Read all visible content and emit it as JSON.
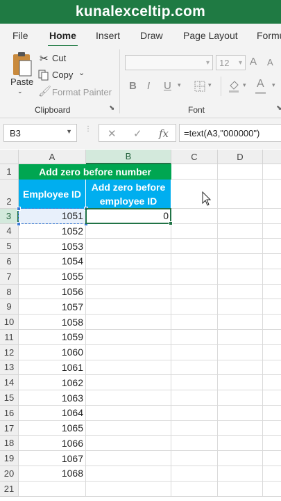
{
  "banner": {
    "text": "kunalexceltip.com",
    "bg": "#1f7a43"
  },
  "ribbon_tabs": [
    "File",
    "Home",
    "Insert",
    "Draw",
    "Page Layout",
    "Formu"
  ],
  "active_tab": "Home",
  "clipboard": {
    "paste_label": "Paste",
    "cut_label": "Cut",
    "copy_label": "Copy",
    "format_painter_label": "Format Painter",
    "group_label": "Clipboard"
  },
  "font": {
    "size_value": "12",
    "group_label": "Font",
    "bold": "B",
    "italic": "I",
    "underline": "U",
    "grow": "A",
    "shrink": "A"
  },
  "formula_bar": {
    "name_box": "B3",
    "cancel_icon": "✕",
    "enter_icon": "✓",
    "fx_label": "fx",
    "formula": "=text(A3,\"000000\")"
  },
  "columns": [
    "A",
    "B",
    "C",
    "D"
  ],
  "selected_column": "B",
  "rows": [
    "1",
    "2",
    "3",
    "4",
    "5",
    "6",
    "7",
    "8",
    "9",
    "10",
    "11",
    "12",
    "13",
    "14",
    "15",
    "16",
    "17",
    "18",
    "19",
    "20",
    "21"
  ],
  "selected_row": "3",
  "sheet": {
    "title_merged": "Add zero before number",
    "col_a_header": "Employee ID",
    "col_b_header_line1": "Add zero before",
    "col_b_header_line2": "employee ID",
    "employee_ids": [
      "1051",
      "1052",
      "1053",
      "1054",
      "1055",
      "1056",
      "1057",
      "1058",
      "1059",
      "1060",
      "1061",
      "1062",
      "1063",
      "1064",
      "1065",
      "1066",
      "1067",
      "1068"
    ],
    "b3_value": "0"
  },
  "colors": {
    "title_fill": "#00a651",
    "header_fill": "#00aeef",
    "selection": "#217346"
  }
}
